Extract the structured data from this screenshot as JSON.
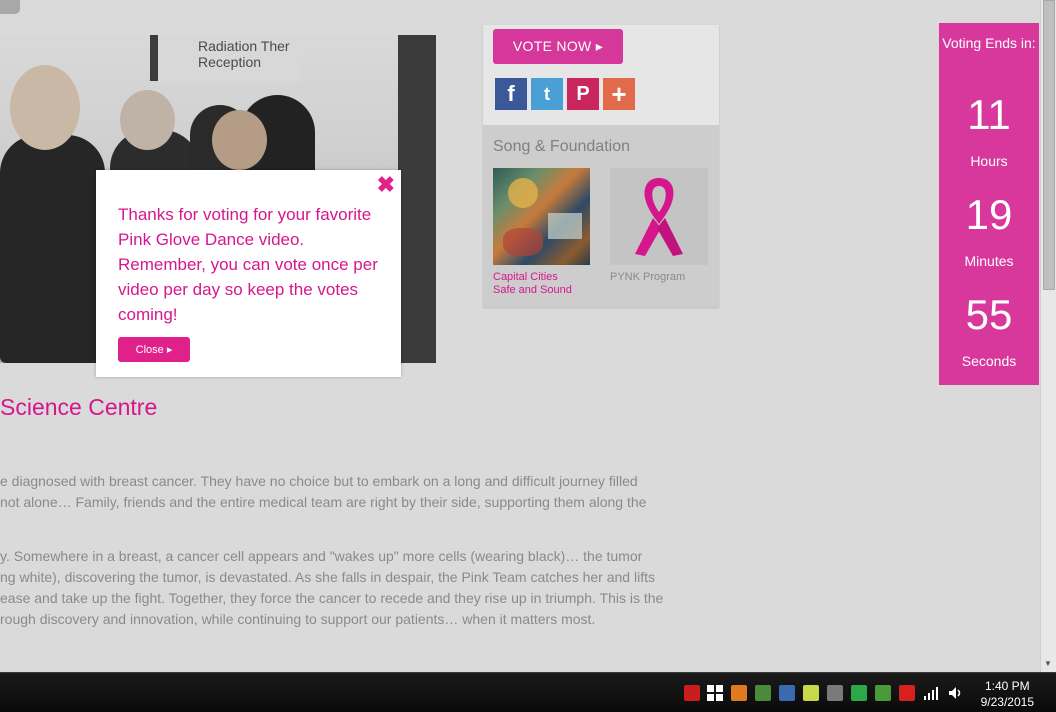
{
  "popup": {
    "close_x": "✖",
    "message": "Thanks for voting for your favorite Pink Glove Dance video. Remember, you can vote once per video per day so keep the votes coming!",
    "close_label": "Close ▸"
  },
  "video": {
    "sign_line1": "Radiation Ther",
    "sign_line2": "Reception"
  },
  "vote_panel": {
    "vote_label": "VOTE NOW ▸",
    "social": [
      {
        "name": "facebook-icon",
        "glyph": "f",
        "color": "#3b5998"
      },
      {
        "name": "twitter-icon",
        "glyph": "t",
        "color": "#4a9fd6"
      },
      {
        "name": "pinterest-icon",
        "glyph": "P",
        "color": "#c9265e"
      },
      {
        "name": "share-plus-icon",
        "glyph": "+",
        "color": "#e06a4a"
      }
    ],
    "section_title": "Song & Foundation",
    "song_line1": "Capital Cities",
    "song_line2": "Safe and Sound",
    "foundation_label": "PYNK Program"
  },
  "countdown": {
    "header": "Voting Ends in:",
    "hours": "11",
    "hours_label": "Hours",
    "minutes": "19",
    "minutes_label": "Minutes",
    "seconds": "55",
    "seconds_label": "Seconds"
  },
  "article": {
    "heading": "Science Centre",
    "p1": [
      "e diagnosed with breast cancer.   They have no choice but to embark on a long and difficult journey filled",
      "not alone…  Family, friends and the entire medical team are right by their side, supporting them along the"
    ],
    "p2": [
      "y.  Somewhere in a breast, a cancer cell appears and \"wakes up\" more cells (wearing black)…  the tumor",
      "ng white),  discovering the tumor,  is devastated. As she falls in despair, the Pink Team catches her and lifts",
      "ease and take up the fight.  Together, they force the cancer to recede and they rise up in triumph.  This is the",
      "rough discovery and innovation, while continuing to support our patients… when it matters most."
    ]
  },
  "taskbar": {
    "time": "1:40 PM",
    "date": "9/23/2015"
  }
}
